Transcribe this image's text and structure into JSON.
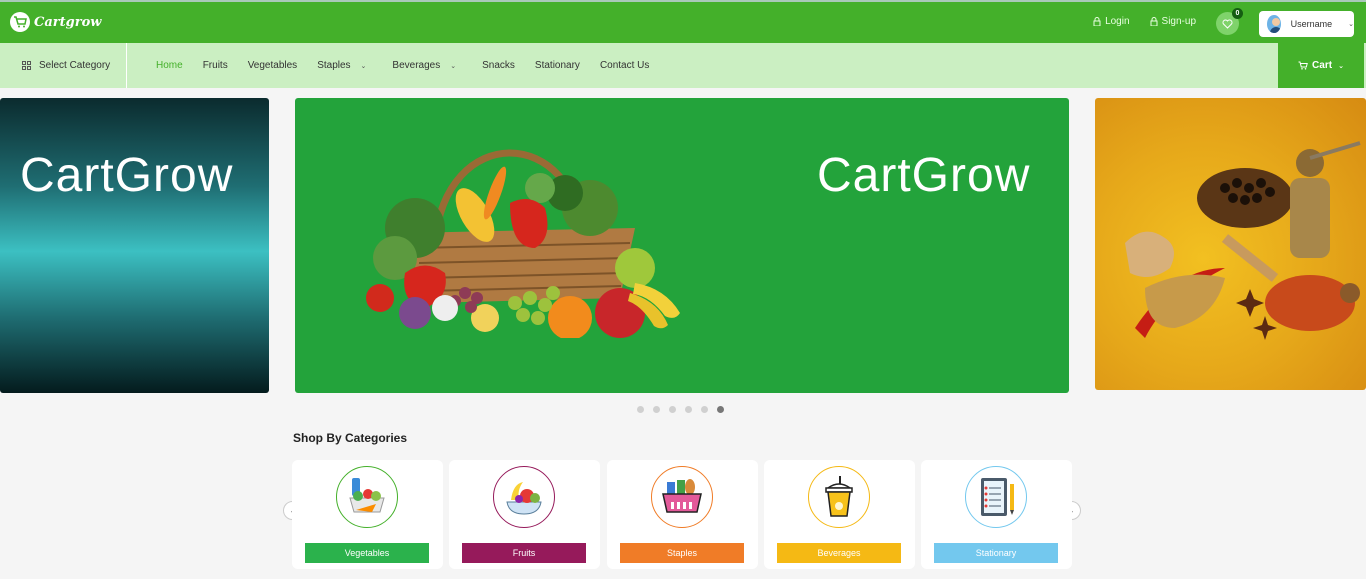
{
  "header": {
    "logo_text": "Cartgrow",
    "login_label": "Login",
    "signup_label": "Sign-up",
    "wishlist_count": "0",
    "username": "Username"
  },
  "nav": {
    "select_category": "Select Category",
    "items": [
      {
        "label": "Home",
        "active": true
      },
      {
        "label": "Fruits"
      },
      {
        "label": "Vegetables"
      },
      {
        "label": "Staples",
        "dropdown": true
      },
      {
        "label": "Beverages",
        "dropdown": true
      },
      {
        "label": "Snacks"
      },
      {
        "label": "Stationary"
      },
      {
        "label": "Contact Us"
      }
    ],
    "cart_label": "Cart"
  },
  "carousel": {
    "left_brand": "CartGrow",
    "main_brand": "CartGrow",
    "dot_count": 6,
    "active_dot": 5
  },
  "categories": {
    "title": "Shop By Categories",
    "items": [
      {
        "label": "Vegetables",
        "color": "#2bb24c",
        "ring": "#44b02a",
        "icon": "vegetables-icon"
      },
      {
        "label": "Fruits",
        "color": "#961a5b",
        "ring": "#961a5b",
        "icon": "fruits-icon"
      },
      {
        "label": "Staples",
        "color": "#f07c27",
        "ring": "#f07c27",
        "icon": "staples-basket-icon"
      },
      {
        "label": "Beverages",
        "color": "#f5b914",
        "ring": "#f5b914",
        "icon": "beverage-cup-icon"
      },
      {
        "label": "Stationary",
        "color": "#73c8ee",
        "ring": "#73c8ee",
        "icon": "notebook-icon"
      }
    ]
  },
  "colors": {
    "brand_green": "#44b02a",
    "nav_bg": "#cbefc2",
    "slide_green": "#23a33b"
  }
}
